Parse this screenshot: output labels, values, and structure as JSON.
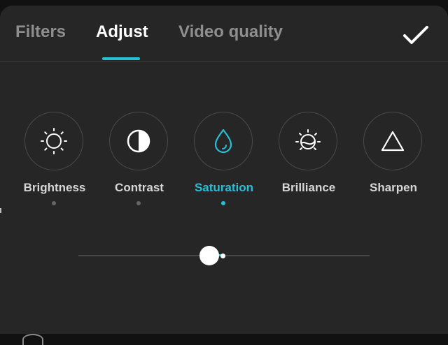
{
  "tabs": [
    {
      "label": "Filters",
      "active": false
    },
    {
      "label": "Adjust",
      "active": true
    },
    {
      "label": "Video quality",
      "active": false
    }
  ],
  "confirm_icon": "checkmark-icon",
  "tools": [
    {
      "label": "Brightness",
      "icon": "sun-icon",
      "active": false
    },
    {
      "label": "Contrast",
      "icon": "contrast-icon",
      "active": false
    },
    {
      "label": "Saturation",
      "icon": "drop-icon",
      "active": true
    },
    {
      "label": "Brilliance",
      "icon": "brilliance-icon",
      "active": false
    },
    {
      "label": "Sharpen",
      "icon": "triangle-icon",
      "active": false
    }
  ],
  "slider": {
    "value": 0.45,
    "center": 0.5
  },
  "colors": {
    "accent": "#25c0d4",
    "background": "#262626",
    "text_active": "#ffffff",
    "text_inactive": "#8e8e8e"
  }
}
